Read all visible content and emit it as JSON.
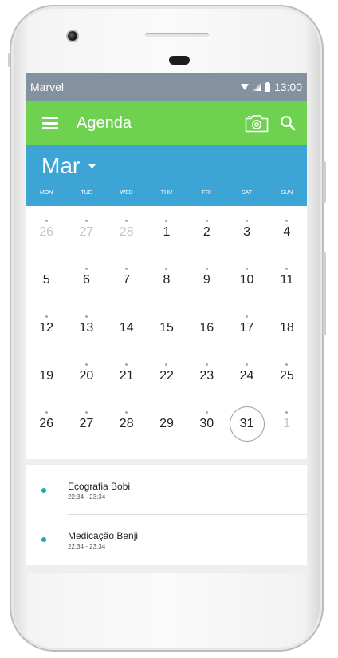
{
  "status_bar": {
    "carrier": "Marvel",
    "time": "13:00"
  },
  "app_bar": {
    "title": "Agenda",
    "menu_icon": "hamburger-menu-icon",
    "camera_icon": "camera-icon",
    "search_icon": "search-icon"
  },
  "month_bar": {
    "month": "Mar",
    "dropdown_icon": "caret-down-icon",
    "weekdays": [
      "MON",
      "TUE",
      "WED",
      "THU",
      "FRI",
      "SAT",
      "SUN"
    ]
  },
  "calendar": {
    "days": [
      {
        "d": "26",
        "muted": true,
        "dot": true
      },
      {
        "d": "27",
        "muted": true,
        "dot": true
      },
      {
        "d": "28",
        "muted": true,
        "dot": true
      },
      {
        "d": "1",
        "muted": false,
        "dot": true
      },
      {
        "d": "2",
        "muted": false,
        "dot": true
      },
      {
        "d": "3",
        "muted": false,
        "dot": true
      },
      {
        "d": "4",
        "muted": false,
        "dot": true
      },
      {
        "d": "5",
        "muted": false,
        "dot": false
      },
      {
        "d": "6",
        "muted": false,
        "dot": true
      },
      {
        "d": "7",
        "muted": false,
        "dot": true
      },
      {
        "d": "8",
        "muted": false,
        "dot": true
      },
      {
        "d": "9",
        "muted": false,
        "dot": true
      },
      {
        "d": "10",
        "muted": false,
        "dot": true
      },
      {
        "d": "11",
        "muted": false,
        "dot": true
      },
      {
        "d": "12",
        "muted": false,
        "dot": true
      },
      {
        "d": "13",
        "muted": false,
        "dot": true
      },
      {
        "d": "14",
        "muted": false,
        "dot": false
      },
      {
        "d": "15",
        "muted": false,
        "dot": false
      },
      {
        "d": "16",
        "muted": false,
        "dot": false
      },
      {
        "d": "17",
        "muted": false,
        "dot": true
      },
      {
        "d": "18",
        "muted": false,
        "dot": false
      },
      {
        "d": "19",
        "muted": false,
        "dot": false
      },
      {
        "d": "20",
        "muted": false,
        "dot": true
      },
      {
        "d": "21",
        "muted": false,
        "dot": true
      },
      {
        "d": "22",
        "muted": false,
        "dot": true
      },
      {
        "d": "23",
        "muted": false,
        "dot": true
      },
      {
        "d": "24",
        "muted": false,
        "dot": true
      },
      {
        "d": "25",
        "muted": false,
        "dot": true
      },
      {
        "d": "26",
        "muted": false,
        "dot": true
      },
      {
        "d": "27",
        "muted": false,
        "dot": true
      },
      {
        "d": "28",
        "muted": false,
        "dot": true
      },
      {
        "d": "29",
        "muted": false,
        "dot": false
      },
      {
        "d": "30",
        "muted": false,
        "dot": true
      },
      {
        "d": "31",
        "muted": false,
        "dot": false,
        "today": true
      },
      {
        "d": "1",
        "muted": true,
        "dot": true
      }
    ]
  },
  "events": [
    {
      "name": "Ecografia Bobi",
      "time": "22:34 - 23:34"
    },
    {
      "name": "Medicação Benji",
      "time": "22:34 - 23:34"
    }
  ],
  "colors": {
    "status_bar": "#8492a0",
    "app_bar": "#6fd150",
    "month_bar": "#3ca5d6",
    "event_dot": "#1eaaa3"
  }
}
